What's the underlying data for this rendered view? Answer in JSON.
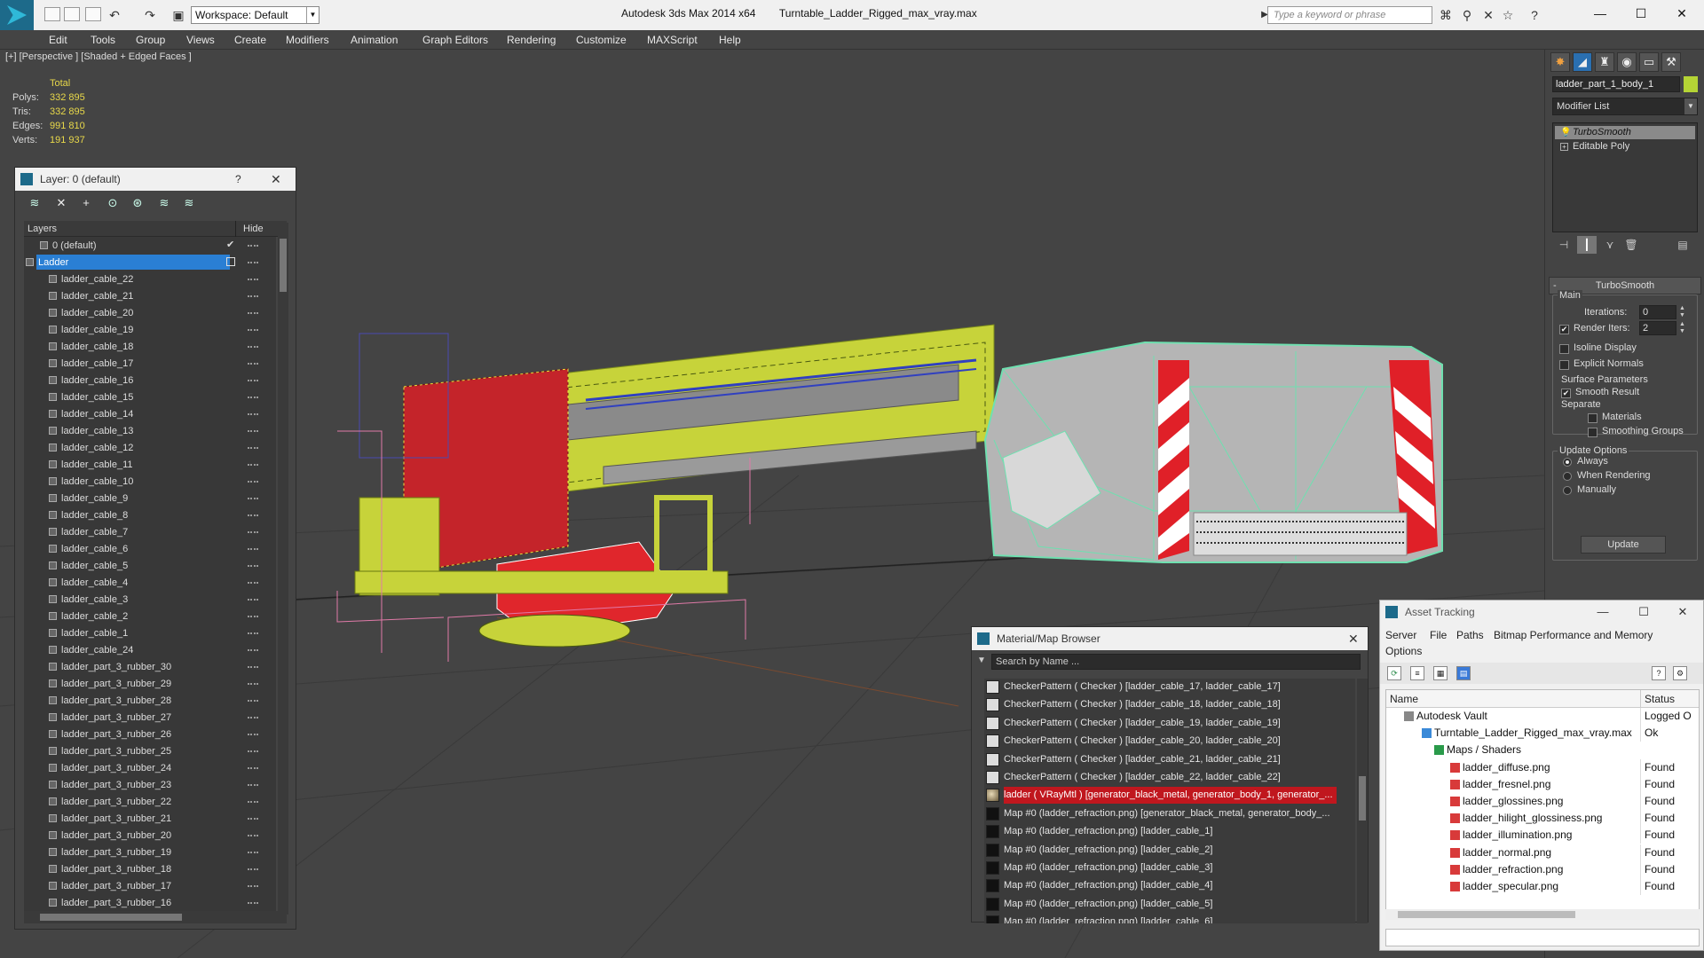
{
  "titlebar": {
    "workspace": "Workspace: Default",
    "app_name": "Autodesk 3ds Max  2014 x64",
    "file_name": "Turntable_Ladder_Rigged_max_vray.max",
    "search_placeholder": "Type a keyword or phrase"
  },
  "menubar": [
    "Edit",
    "Tools",
    "Group",
    "Views",
    "Create",
    "Modifiers",
    "Animation",
    "Graph Editors",
    "Rendering",
    "Customize",
    "MAXScript",
    "Help"
  ],
  "viewport": {
    "label": "[+] [Perspective ] [Shaded + Edged Faces ]",
    "stats": {
      "header": "Total",
      "rows": [
        {
          "label": "Polys:",
          "value": "332 895"
        },
        {
          "label": "Tris:",
          "value": "332 895"
        },
        {
          "label": "Edges:",
          "value": "991 810"
        },
        {
          "label": "Verts:",
          "value": "191 937"
        }
      ]
    }
  },
  "command_panel": {
    "object_name": "ladder_part_1_body_1",
    "object_color": "#b5d435",
    "modifier_list": "Modifier List",
    "stack": [
      "TurboSmooth",
      "Editable Poly"
    ],
    "rollout_title": "TurboSmooth",
    "main_label": "Main",
    "iterations_label": "Iterations:",
    "iterations_value": "0",
    "render_iters_label": "Render Iters:",
    "render_iters_value": "2",
    "isoline": "Isoline Display",
    "explicit": "Explicit Normals",
    "surface_params": "Surface Parameters",
    "smooth_result": "Smooth Result",
    "separate": "Separate",
    "materials": "Materials",
    "smoothing_groups": "Smoothing Groups",
    "update_options": "Update Options",
    "always": "Always",
    "when_rendering": "When Rendering",
    "manually": "Manually",
    "update_button": "Update"
  },
  "layer_panel": {
    "title": "Layer: 0 (default)",
    "help": "?",
    "col_layers": "Layers",
    "col_hide": "Hide",
    "rows": [
      "0 (default)",
      "Ladder",
      "ladder_cable_22",
      "ladder_cable_21",
      "ladder_cable_20",
      "ladder_cable_19",
      "ladder_cable_18",
      "ladder_cable_17",
      "ladder_cable_16",
      "ladder_cable_15",
      "ladder_cable_14",
      "ladder_cable_13",
      "ladder_cable_12",
      "ladder_cable_11",
      "ladder_cable_10",
      "ladder_cable_9",
      "ladder_cable_8",
      "ladder_cable_7",
      "ladder_cable_6",
      "ladder_cable_5",
      "ladder_cable_4",
      "ladder_cable_3",
      "ladder_cable_2",
      "ladder_cable_1",
      "ladder_cable_24",
      "ladder_part_3_rubber_30",
      "ladder_part_3_rubber_29",
      "ladder_part_3_rubber_28",
      "ladder_part_3_rubber_27",
      "ladder_part_3_rubber_26",
      "ladder_part_3_rubber_25",
      "ladder_part_3_rubber_24",
      "ladder_part_3_rubber_23",
      "ladder_part_3_rubber_22",
      "ladder_part_3_rubber_21",
      "ladder_part_3_rubber_20",
      "ladder_part_3_rubber_19",
      "ladder_part_3_rubber_18",
      "ladder_part_3_rubber_17",
      "ladder_part_3_rubber_16"
    ]
  },
  "material_browser": {
    "title": "Material/Map Browser",
    "search_placeholder": "Search by Name ...",
    "rows": [
      "CheckerPattern  ( Checker )  [ladder_cable_17, ladder_cable_17]",
      "CheckerPattern  ( Checker )  [ladder_cable_18, ladder_cable_18]",
      "CheckerPattern  ( Checker )  [ladder_cable_19, ladder_cable_19]",
      "CheckerPattern  ( Checker )  [ladder_cable_20, ladder_cable_20]",
      "CheckerPattern  ( Checker )  [ladder_cable_21, ladder_cable_21]",
      "CheckerPattern  ( Checker )  [ladder_cable_22, ladder_cable_22]",
      "ladder  ( VRayMtl )  [generator_black_metal, generator_body_1, generator_...",
      "Map #0 (ladder_refraction.png)  [generator_black_metal, generator_body_...",
      "Map #0 (ladder_refraction.png)  [ladder_cable_1]",
      "Map #0 (ladder_refraction.png)  [ladder_cable_2]",
      "Map #0 (ladder_refraction.png)  [ladder_cable_3]",
      "Map #0 (ladder_refraction.png)  [ladder_cable_4]",
      "Map #0 (ladder_refraction.png)  [ladder_cable_5]",
      "Map #0 (ladder_refraction.png)  [ladder_cable_6]"
    ]
  },
  "asset_tracking": {
    "title": "Asset Tracking",
    "menu": [
      "Server",
      "File",
      "Paths",
      "Bitmap Performance and Memory",
      "Options"
    ],
    "col_name": "Name",
    "col_status": "Status",
    "rows": [
      {
        "name": "Autodesk Vault",
        "status": "Logged O"
      },
      {
        "name": "Turntable_Ladder_Rigged_max_vray.max",
        "status": "Ok"
      },
      {
        "name": "Maps / Shaders",
        "status": ""
      },
      {
        "name": "ladder_diffuse.png",
        "status": "Found"
      },
      {
        "name": "ladder_fresnel.png",
        "status": "Found"
      },
      {
        "name": "ladder_glossines.png",
        "status": "Found"
      },
      {
        "name": "ladder_hilight_glossiness.png",
        "status": "Found"
      },
      {
        "name": "ladder_illumination.png",
        "status": "Found"
      },
      {
        "name": "ladder_normal.png",
        "status": "Found"
      },
      {
        "name": "ladder_refraction.png",
        "status": "Found"
      },
      {
        "name": "ladder_specular.png",
        "status": "Found"
      }
    ]
  }
}
